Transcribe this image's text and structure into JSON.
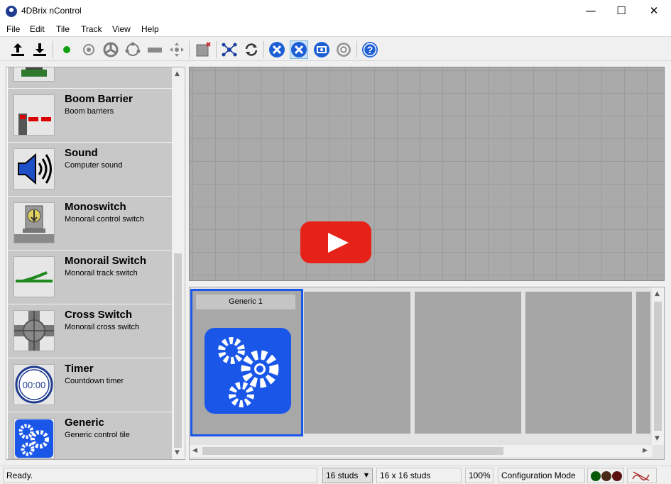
{
  "window": {
    "title": "4DBrix nControl",
    "controls": {
      "minimize": "—",
      "maximize": "☐",
      "close": "✕"
    }
  },
  "menu": [
    "File",
    "Edit",
    "Tile",
    "Track",
    "View",
    "Help"
  ],
  "toolbar": {
    "icons": [
      "upload-icon",
      "download-icon",
      "green-dot-icon",
      "target-icon",
      "wheel-icon",
      "circle-dots-icon",
      "bar-icon",
      "move-icon",
      "delete-tile-icon",
      "network-icon",
      "refresh-icon",
      "tools-icon",
      "tools-active-icon",
      "screen-icon",
      "gear-icon",
      "help-icon"
    ],
    "help_label": "?"
  },
  "tile_list": [
    {
      "name": "",
      "description": "",
      "icon": "signal-partial-icon"
    },
    {
      "name": "Boom Barrier",
      "description": "Boom barriers",
      "icon": "boom-barrier-icon"
    },
    {
      "name": "Sound",
      "description": "Computer sound",
      "icon": "speaker-icon"
    },
    {
      "name": "Monoswitch",
      "description": "Monorail control switch",
      "icon": "monoswitch-icon"
    },
    {
      "name": "Monorail Switch",
      "description": "Monorail track switch",
      "icon": "monorail-switch-icon"
    },
    {
      "name": "Cross Switch",
      "description": "Monorail cross switch",
      "icon": "cross-switch-icon"
    },
    {
      "name": "Timer",
      "description": "Countdown timer",
      "icon": "timer-icon",
      "timer_text": "00:00"
    },
    {
      "name": "Generic",
      "description": "Generic control tile",
      "icon": "generic-gears-icon"
    }
  ],
  "tiles_panel": {
    "cards": [
      {
        "header": "Generic 1",
        "selected": true
      },
      {
        "header": "",
        "selected": false
      },
      {
        "header": "",
        "selected": false
      },
      {
        "header": "",
        "selected": false
      },
      {
        "header": "",
        "selected": false
      }
    ]
  },
  "statusbar": {
    "status": "Ready.",
    "stud_select": "16 studs",
    "grid_size": "16 x 16 studs",
    "zoom": "100%",
    "mode": "Configuration Mode",
    "leds": [
      "#0a5a0a",
      "#4a2a18",
      "#5a1010"
    ]
  },
  "colors": {
    "accent": "#1a56e8",
    "video_play": "#e62117"
  }
}
